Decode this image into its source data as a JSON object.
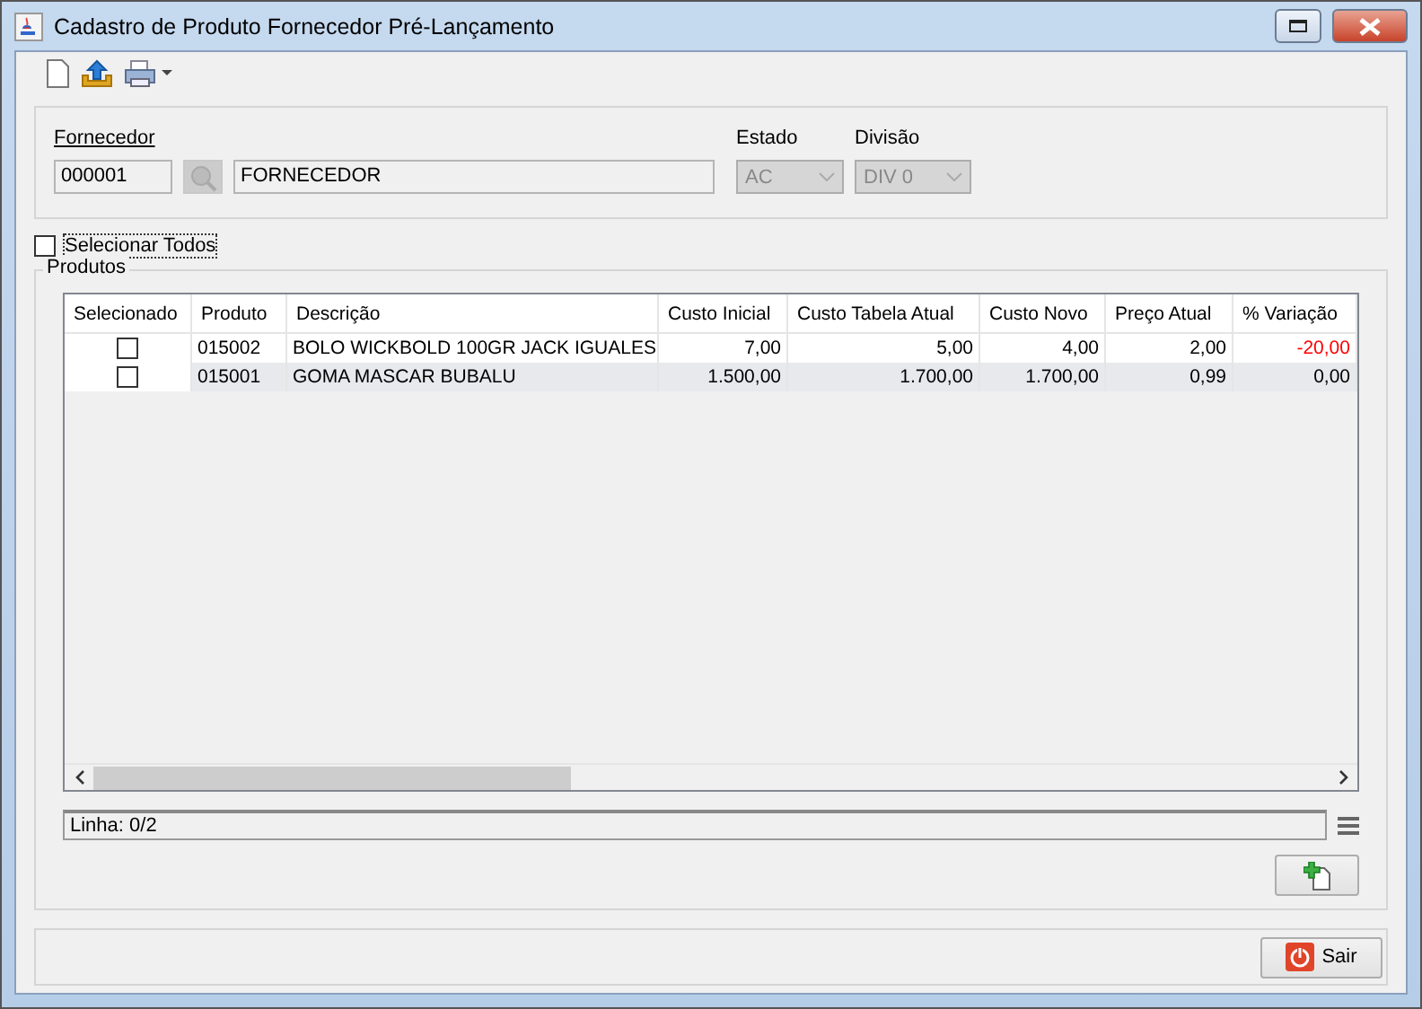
{
  "window": {
    "title": "Cadastro de Produto Fornecedor Pré-Lançamento"
  },
  "supplier": {
    "label": "Fornecedor",
    "code": "000001",
    "name": "FORNECEDOR"
  },
  "state": {
    "label": "Estado",
    "value": "AC",
    "disabled": true
  },
  "division": {
    "label": "Divisão",
    "value": "DIV 0",
    "disabled": true
  },
  "select_all": {
    "label": "Selecionar Todos",
    "checked": false
  },
  "products": {
    "title": "Produtos",
    "columns": [
      "Selecionado",
      "Produto",
      "Descrição",
      "Custo Inicial",
      "Custo Tabela Atual",
      "Custo Novo",
      "Preço Atual",
      "% Variação"
    ],
    "rows": [
      {
        "cells": [
          {
            "kind": "checkbox",
            "checked": false
          },
          {
            "kind": "text",
            "text": "015002"
          },
          {
            "kind": "text",
            "text": "BOLO WICKBOLD 100GR JACK IGUALES"
          },
          {
            "kind": "text",
            "text": "7,00"
          },
          {
            "kind": "text",
            "text": "5,00"
          },
          {
            "kind": "text",
            "text": "4,00"
          },
          {
            "kind": "text",
            "text": "2,00"
          },
          {
            "kind": "text",
            "text": "-20,00",
            "color": "#ff0000"
          }
        ]
      },
      {
        "cells": [
          {
            "kind": "checkbox",
            "checked": false
          },
          {
            "kind": "text",
            "text": "015001"
          },
          {
            "kind": "text",
            "text": "GOMA MASCAR BUBALU"
          },
          {
            "kind": "text",
            "text": "1.500,00"
          },
          {
            "kind": "text",
            "text": "1.700,00"
          },
          {
            "kind": "text",
            "text": "1.700,00"
          },
          {
            "kind": "text",
            "text": "0,99"
          },
          {
            "kind": "text",
            "text": "0,00",
            "color": "#000000"
          }
        ]
      }
    ]
  },
  "status": {
    "text": "Linha: 0/2"
  },
  "buttons": [
    {
      "label": "Sair"
    }
  ]
}
